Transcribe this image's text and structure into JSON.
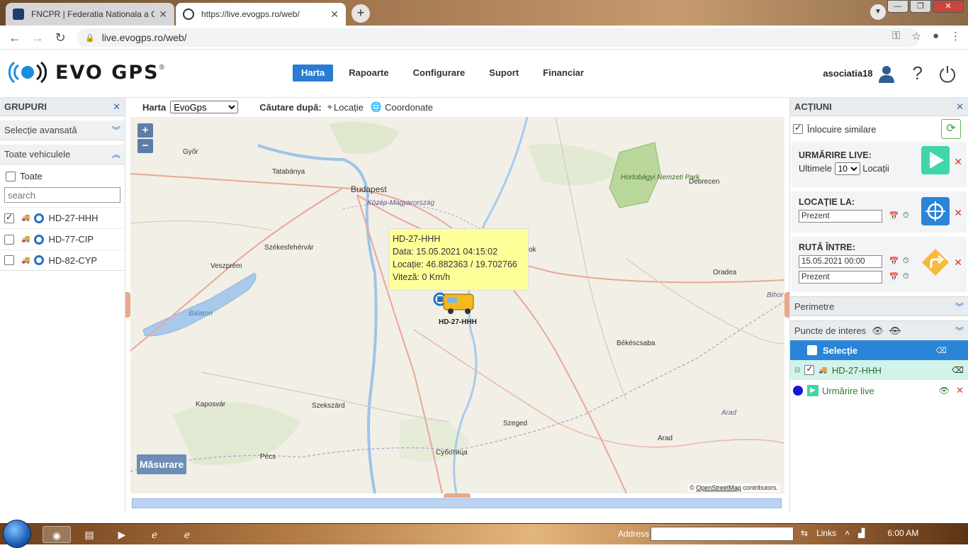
{
  "browser": {
    "tabs": [
      {
        "title": "FNCPR | Federatia Nationala a Cr",
        "active": false
      },
      {
        "title": "https://live.evogps.ro/web/",
        "active": true
      }
    ],
    "url": "live.evogps.ro/web/"
  },
  "header": {
    "logo_text": "EVO GPS",
    "logo_mark": "®",
    "nav": [
      "Harta",
      "Rapoarte",
      "Configurare",
      "Suport",
      "Financiar"
    ],
    "username": "asociatia18"
  },
  "left": {
    "title": "GRUPURI",
    "advanced": "Selecție avansată",
    "all_vehicles": "Toate vehiculele",
    "select_all": "Toate",
    "search_placeholder": "search",
    "vehicles": [
      {
        "name": "HD-27-HHH",
        "checked": true
      },
      {
        "name": "HD-77-CIP",
        "checked": false
      },
      {
        "name": "HD-82-CYP",
        "checked": false
      }
    ]
  },
  "mapbar": {
    "map_label": "Harta",
    "map_provider": "EvoGps",
    "search_label": "Căutare după:",
    "by_location": "Locație",
    "by_coords": "Coordonate"
  },
  "map": {
    "measure": "Măsurare",
    "popup": {
      "title": "HD-27-HHH",
      "date": "Data: 15.05.2021 04:15:02",
      "location": "Locație: 46.882363 / 19.702766",
      "speed": "Viteză: 0 Km/h"
    },
    "vehicle_label": "HD-27-HHH",
    "attribution_prefix": "©",
    "attribution_link": "OpenStreetMap",
    "attribution_suffix": "contributors.",
    "cities": {
      "gyor": "Győr",
      "tatabanya": "Tatabánya",
      "budapest": "Budapest",
      "kozep": "Közép-Magyarország",
      "szekesfehervar": "Székesfehérvár",
      "veszprem": "Veszprém",
      "balaton": "Balaton",
      "hortobagy": "Hortobágyi Nemzeti Park",
      "debrecen": "Debrecen",
      "oradea": "Oradea",
      "bihor": "Bihor",
      "bekescsaba": "Békéscsaba",
      "kaposvar": "Kaposvár",
      "szekszard": "Szekszárd",
      "szeged": "Szeged",
      "pecs": "Pécs",
      "subotica": "Суботица",
      "arad": "Arad",
      "arad_region": "Arad",
      "kecskemet": "ok"
    }
  },
  "right": {
    "title": "ACȚIUNI",
    "replace_similar": "Înlocuire similare",
    "live_tracking": {
      "label": "URMĂRIRE LIVE:",
      "prefix": "Ultimele",
      "value": "10",
      "suffix": "Locații"
    },
    "location_at": {
      "label": "LOCAȚIE LA:",
      "value": "Prezent"
    },
    "route_between": {
      "label": "RUTĂ ÎNTRE:",
      "from": "15.05.2021 00:00",
      "to": "Prezent"
    },
    "perimeters": "Perimetre",
    "poi": "Puncte de interes",
    "selection": "Selecție",
    "selected_vehicle": "HD-27-HHH",
    "live_row": "Urmărire live"
  },
  "taskbar": {
    "address_label": "Address",
    "links": "Links",
    "clock": "6:00 AM"
  },
  "colors": {
    "accent": "#2a7bd3",
    "play": "#3fd6a8",
    "target": "#2a85d8",
    "route": "#f7b93a",
    "popup": "#ffff99"
  }
}
